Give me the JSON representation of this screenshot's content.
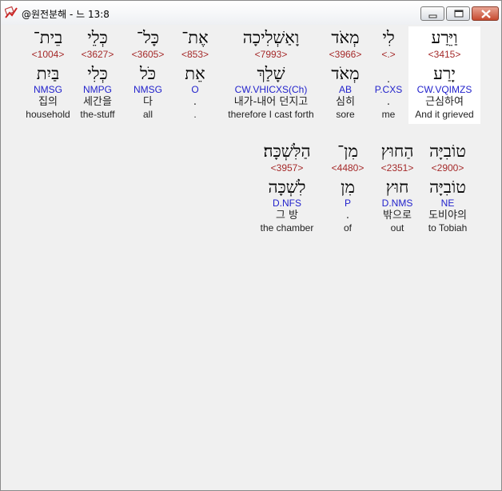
{
  "window": {
    "title": "@원전분해 - 느 13:8",
    "icon": "app-icon",
    "controls": [
      "minimize-icon",
      "maximize-icon",
      "close-icon"
    ]
  },
  "verse": {
    "line1": [
      {
        "heb": "וַיֵּרַע",
        "strong": "<3415>",
        "lemma": "יָרַע",
        "morph": "CW.VQIMZS",
        "kor": "근심하여",
        "eng": "And it grieved",
        "selected": true
      },
      {
        "heb": "לִי",
        "strong": "<.>",
        "lemma": "ׅ",
        "morph": "P.CXS",
        "kor": ".",
        "eng": "me"
      },
      {
        "heb": "מְאֹד",
        "strong": "<3966>",
        "lemma": "מְאֹד",
        "morph": "AB",
        "kor": "심히",
        "eng": "sore"
      },
      {
        "heb": "וָאַשְׁלִיכָה",
        "strong": "<7993>",
        "lemma": "שָׁלַךְ",
        "morph": "CW.VHICXS(Ch)",
        "kor": "내가-내어 던지고",
        "eng": "therefore I cast forth"
      },
      {
        "heb": "אֶת־",
        "strong": "<853>",
        "lemma": "אֵת",
        "morph": "O",
        "kor": ".",
        "eng": "."
      },
      {
        "heb": "כָּל־",
        "strong": "<3605>",
        "lemma": "כֹּל",
        "morph": "NMSG",
        "kor": "다",
        "eng": "all"
      },
      {
        "heb": "כְּלֵי",
        "strong": "<3627>",
        "lemma": "כְּלִי",
        "morph": "NMPG",
        "kor": "세간을",
        "eng": "the-stuff"
      },
      {
        "heb": "בֵית־",
        "strong": "<1004>",
        "lemma": "בַּיִת",
        "morph": "NMSG",
        "kor": "집의",
        "eng": "household"
      }
    ],
    "line2": [
      {
        "heb": "טוֹבִיָּה",
        "strong": "<2900>",
        "lemma": "טוֹבִיָּה",
        "morph": "NE",
        "kor": "도비야의",
        "eng": "to Tobiah"
      },
      {
        "heb": "הַחוּץ",
        "strong": "<2351>",
        "lemma": "חוּץ",
        "morph": "D.NMS",
        "kor": "밖으로",
        "eng": "out"
      },
      {
        "heb": "מִן־",
        "strong": "<4480>",
        "lemma": "מִן",
        "morph": "P",
        "kor": ".",
        "eng": "of"
      },
      {
        "heb": "הַלִּשְׁכָּה׃",
        "strong": "<3957>",
        "lemma": "לִשְׁכָּה",
        "morph": "D.NFS",
        "kor": "그 방",
        "eng": "the chamber"
      }
    ]
  }
}
